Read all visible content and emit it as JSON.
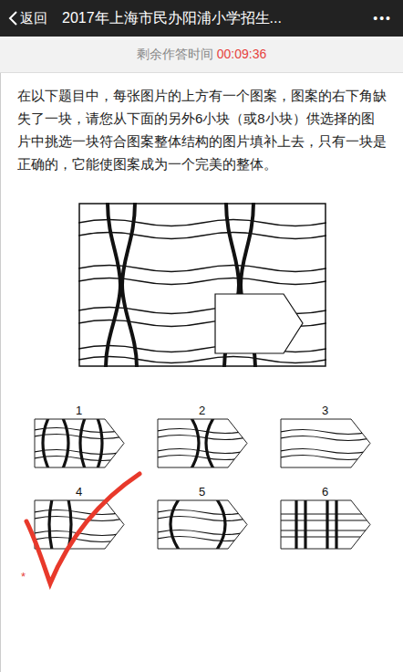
{
  "header": {
    "back": "返回",
    "title": "2017年上海市民办阳浦小学招生...",
    "more": "•••"
  },
  "timer": {
    "label": "剩余作答时间",
    "time": "00:09:36"
  },
  "instructions": "在以下题目中，每张图片的上方有一个图案，图案的右下角缺失了一块，请您从下面的另外6小块（或8小块）供选择的图片中挑选一块符合图案整体结构的图片填补上去，只有一块是正确的，它能使图案成为一个完美的整体。",
  "options": [
    {
      "label": "1",
      "kind": "ovals",
      "marked": false
    },
    {
      "label": "2",
      "kind": "pinch",
      "marked": false
    },
    {
      "label": "3",
      "kind": "waves",
      "marked": false
    },
    {
      "label": "4",
      "kind": "correct",
      "marked": true
    },
    {
      "label": "5",
      "kind": "bars",
      "marked": false
    },
    {
      "label": "6",
      "kind": "grid",
      "marked": false
    }
  ],
  "required_mark": "*"
}
